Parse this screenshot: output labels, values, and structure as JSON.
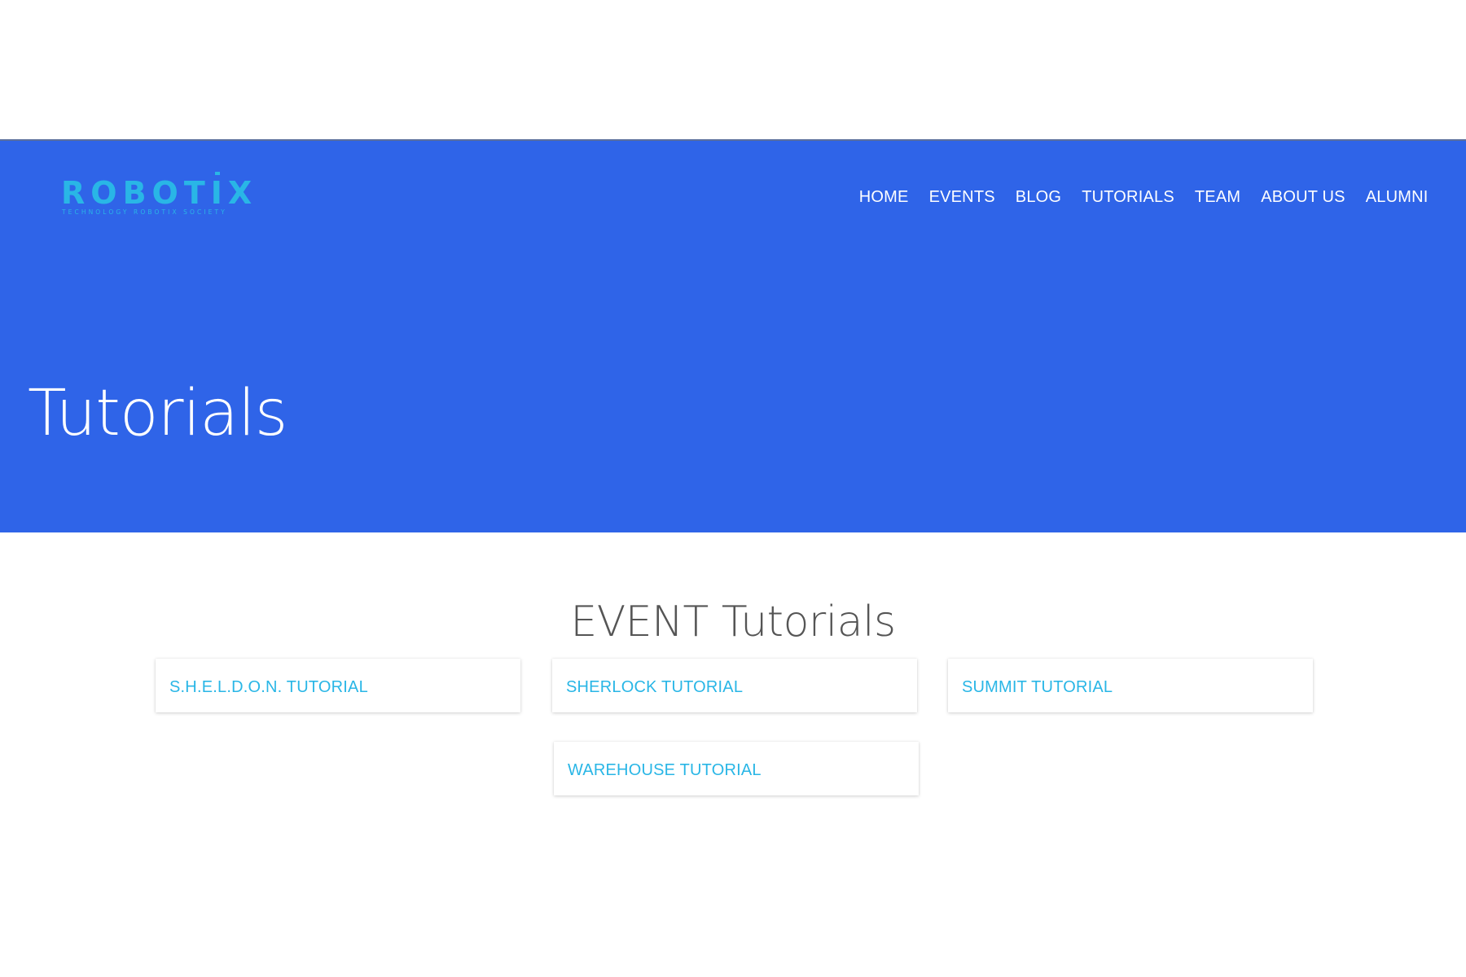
{
  "brand": {
    "logo_text": "ROBOTIX",
    "logo_tagline": "TECHNOLOGY ROBOTIX SOCIETY",
    "logo_color": "#29b6e6"
  },
  "nav": {
    "items": [
      "HOME",
      "EVENTS",
      "BLOG",
      "TUTORIALS",
      "TEAM",
      "ABOUT US",
      "ALUMNI"
    ]
  },
  "hero": {
    "title": "Tutorials",
    "background_color": "#2f64e8"
  },
  "section": {
    "title": "EVENT Tutorials",
    "cards": [
      "S.H.E.L.D.O.N. TUTORIAL",
      "SHERLOCK TUTORIAL",
      "SUMMIT TUTORIAL",
      "WAREHOUSE TUTORIAL"
    ],
    "link_color": "#29b6e6"
  }
}
